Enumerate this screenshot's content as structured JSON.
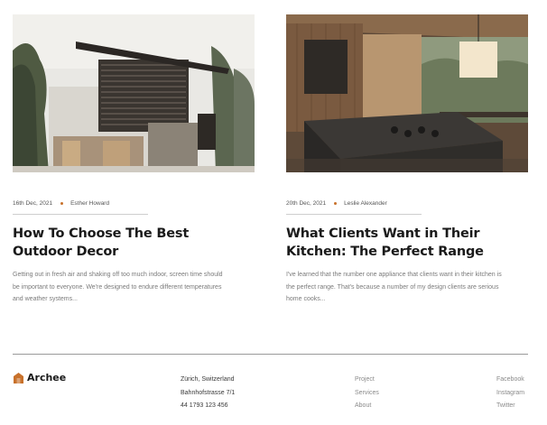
{
  "posts": [
    {
      "date": "16th Dec, 2021",
      "author": "Esther Howard",
      "title_line1": "How To Choose The Best",
      "title_line2": "Outdoor Decor",
      "excerpt": "Getting out in fresh air and shaking off too much indoor, screen time should be important to everyone. We're designed to endure different temperatures and weather systems..."
    },
    {
      "date": "20th Dec, 2021",
      "author": "Leslie Alexander",
      "title_line1": "What Clients Want in Their",
      "title_line2": "Kitchen: The Perfect Range",
      "excerpt": "I've learned that the number one appliance that clients want in their kitchen is the perfect range. That's because a number of my design clients are serious home cooks..."
    }
  ],
  "footer": {
    "brand": "Archee",
    "address": [
      "Zürich, Switzerland",
      "Bahnhofstrasse 7/1",
      "44 1793 123 456"
    ],
    "nav": [
      "Project",
      "Services",
      "About"
    ],
    "social": [
      "Facebook",
      "Instagram",
      "Twitter"
    ]
  },
  "colors": {
    "accent": "#c8712b",
    "text": "#1a1a1a",
    "muted": "#7b7b7b"
  },
  "icons": {
    "brand_logo": "house-logo-icon"
  }
}
